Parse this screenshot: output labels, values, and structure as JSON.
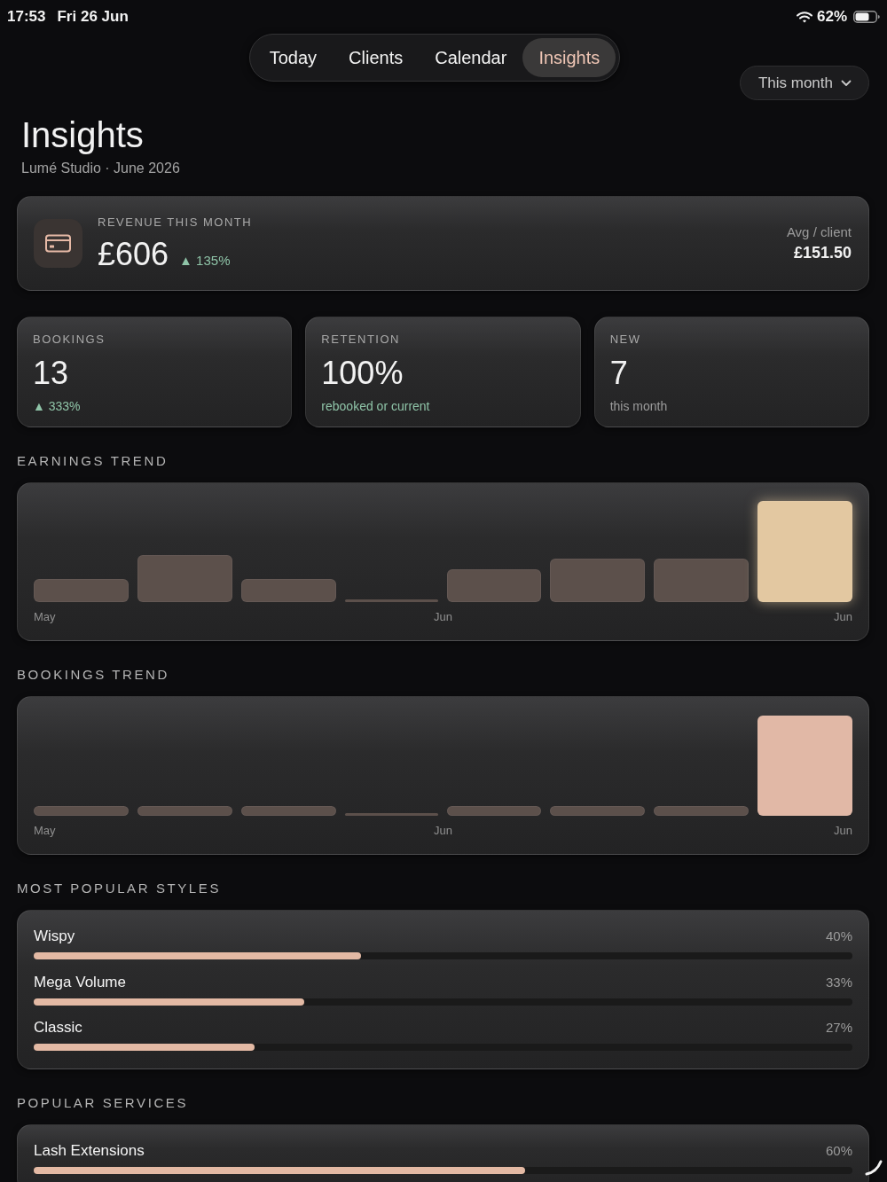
{
  "status_bar": {
    "time": "17:53",
    "date": "Fri 26 Jun",
    "battery": "62%"
  },
  "tabs": [
    {
      "label": "Today",
      "selected": false
    },
    {
      "label": "Clients",
      "selected": false
    },
    {
      "label": "Calendar",
      "selected": false
    },
    {
      "label": "Insights",
      "selected": true
    }
  ],
  "period_dropdown": {
    "label": "This month"
  },
  "header": {
    "title": "Insights",
    "subtitle": "Lumé Studio · June 2026"
  },
  "revenue": {
    "label": "REVENUE THIS MONTH",
    "value": "£606",
    "change": "▲ 135%",
    "side_label": "Avg / client",
    "side_value": "£151.50"
  },
  "stats": [
    {
      "label": "BOOKINGS",
      "value": "13",
      "note": "▲ 333%",
      "kind": "positive"
    },
    {
      "label": "RETENTION",
      "value": "100%",
      "note": "rebooked or current",
      "kind": "positive"
    },
    {
      "label": "NEW",
      "value": "7",
      "note": "this month",
      "kind": "neutral"
    }
  ],
  "trends": [
    {
      "kind": "earnings",
      "heading": "EARNINGS TREND",
      "axis_labels": [
        "May",
        "Jun",
        "Jun"
      ]
    },
    {
      "kind": "bookings",
      "heading": "BOOKINGS TREND",
      "axis_labels": [
        "May",
        "Jun",
        "Jun"
      ]
    }
  ],
  "rankings": [
    {
      "heading": "MOST POPULAR STYLES",
      "items": [
        {
          "name": "Wispy",
          "share": "40%",
          "level": 0.4
        },
        {
          "name": "Mega Volume",
          "share": "33%",
          "level": 0.33
        },
        {
          "name": "Classic",
          "share": "27%",
          "level": 0.27
        }
      ]
    },
    {
      "heading": "POPULAR SERVICES",
      "items": [
        {
          "name": "Lash Extensions",
          "share": "60%",
          "level": 0.6
        }
      ]
    }
  ]
}
